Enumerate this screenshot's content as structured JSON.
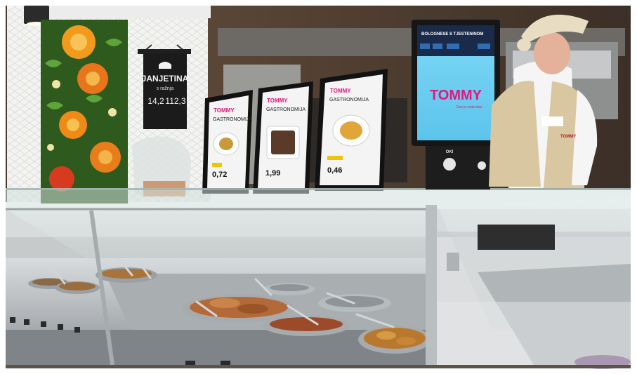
{
  "photo": {
    "subject": "supermarket deli counter",
    "hanging_sign": {
      "title": "JANJETINA",
      "subtitle": "s ražnja",
      "price_old": "14,2",
      "price_new": "112,3"
    },
    "price_cards": [
      {
        "brand": "TOMMY",
        "heading": "GASTRONOMIJA",
        "price": "0,72"
      },
      {
        "brand": "TOMMY",
        "heading": "GASTRONOMIJA",
        "price": "1,99"
      },
      {
        "brand": "TOMMY",
        "heading": "GASTRONOMIJA",
        "price": "0,46"
      }
    ],
    "kiosk": {
      "header_text": "BOLOGNESE S TJESTENINOM",
      "brand_text": "TOMMY",
      "tagline": "Dan je svaki dan",
      "device_label": "OKI"
    },
    "apron_logo": "TOMMY",
    "colors": {
      "wall_tile": "#f4f4f2",
      "dark_panel": "#3a2f29",
      "kiosk_screen": "#6fcff2",
      "tommy_pink": "#e3177d",
      "apron": "#d8c7a0",
      "counter_steel": "#b9bcbf"
    }
  }
}
